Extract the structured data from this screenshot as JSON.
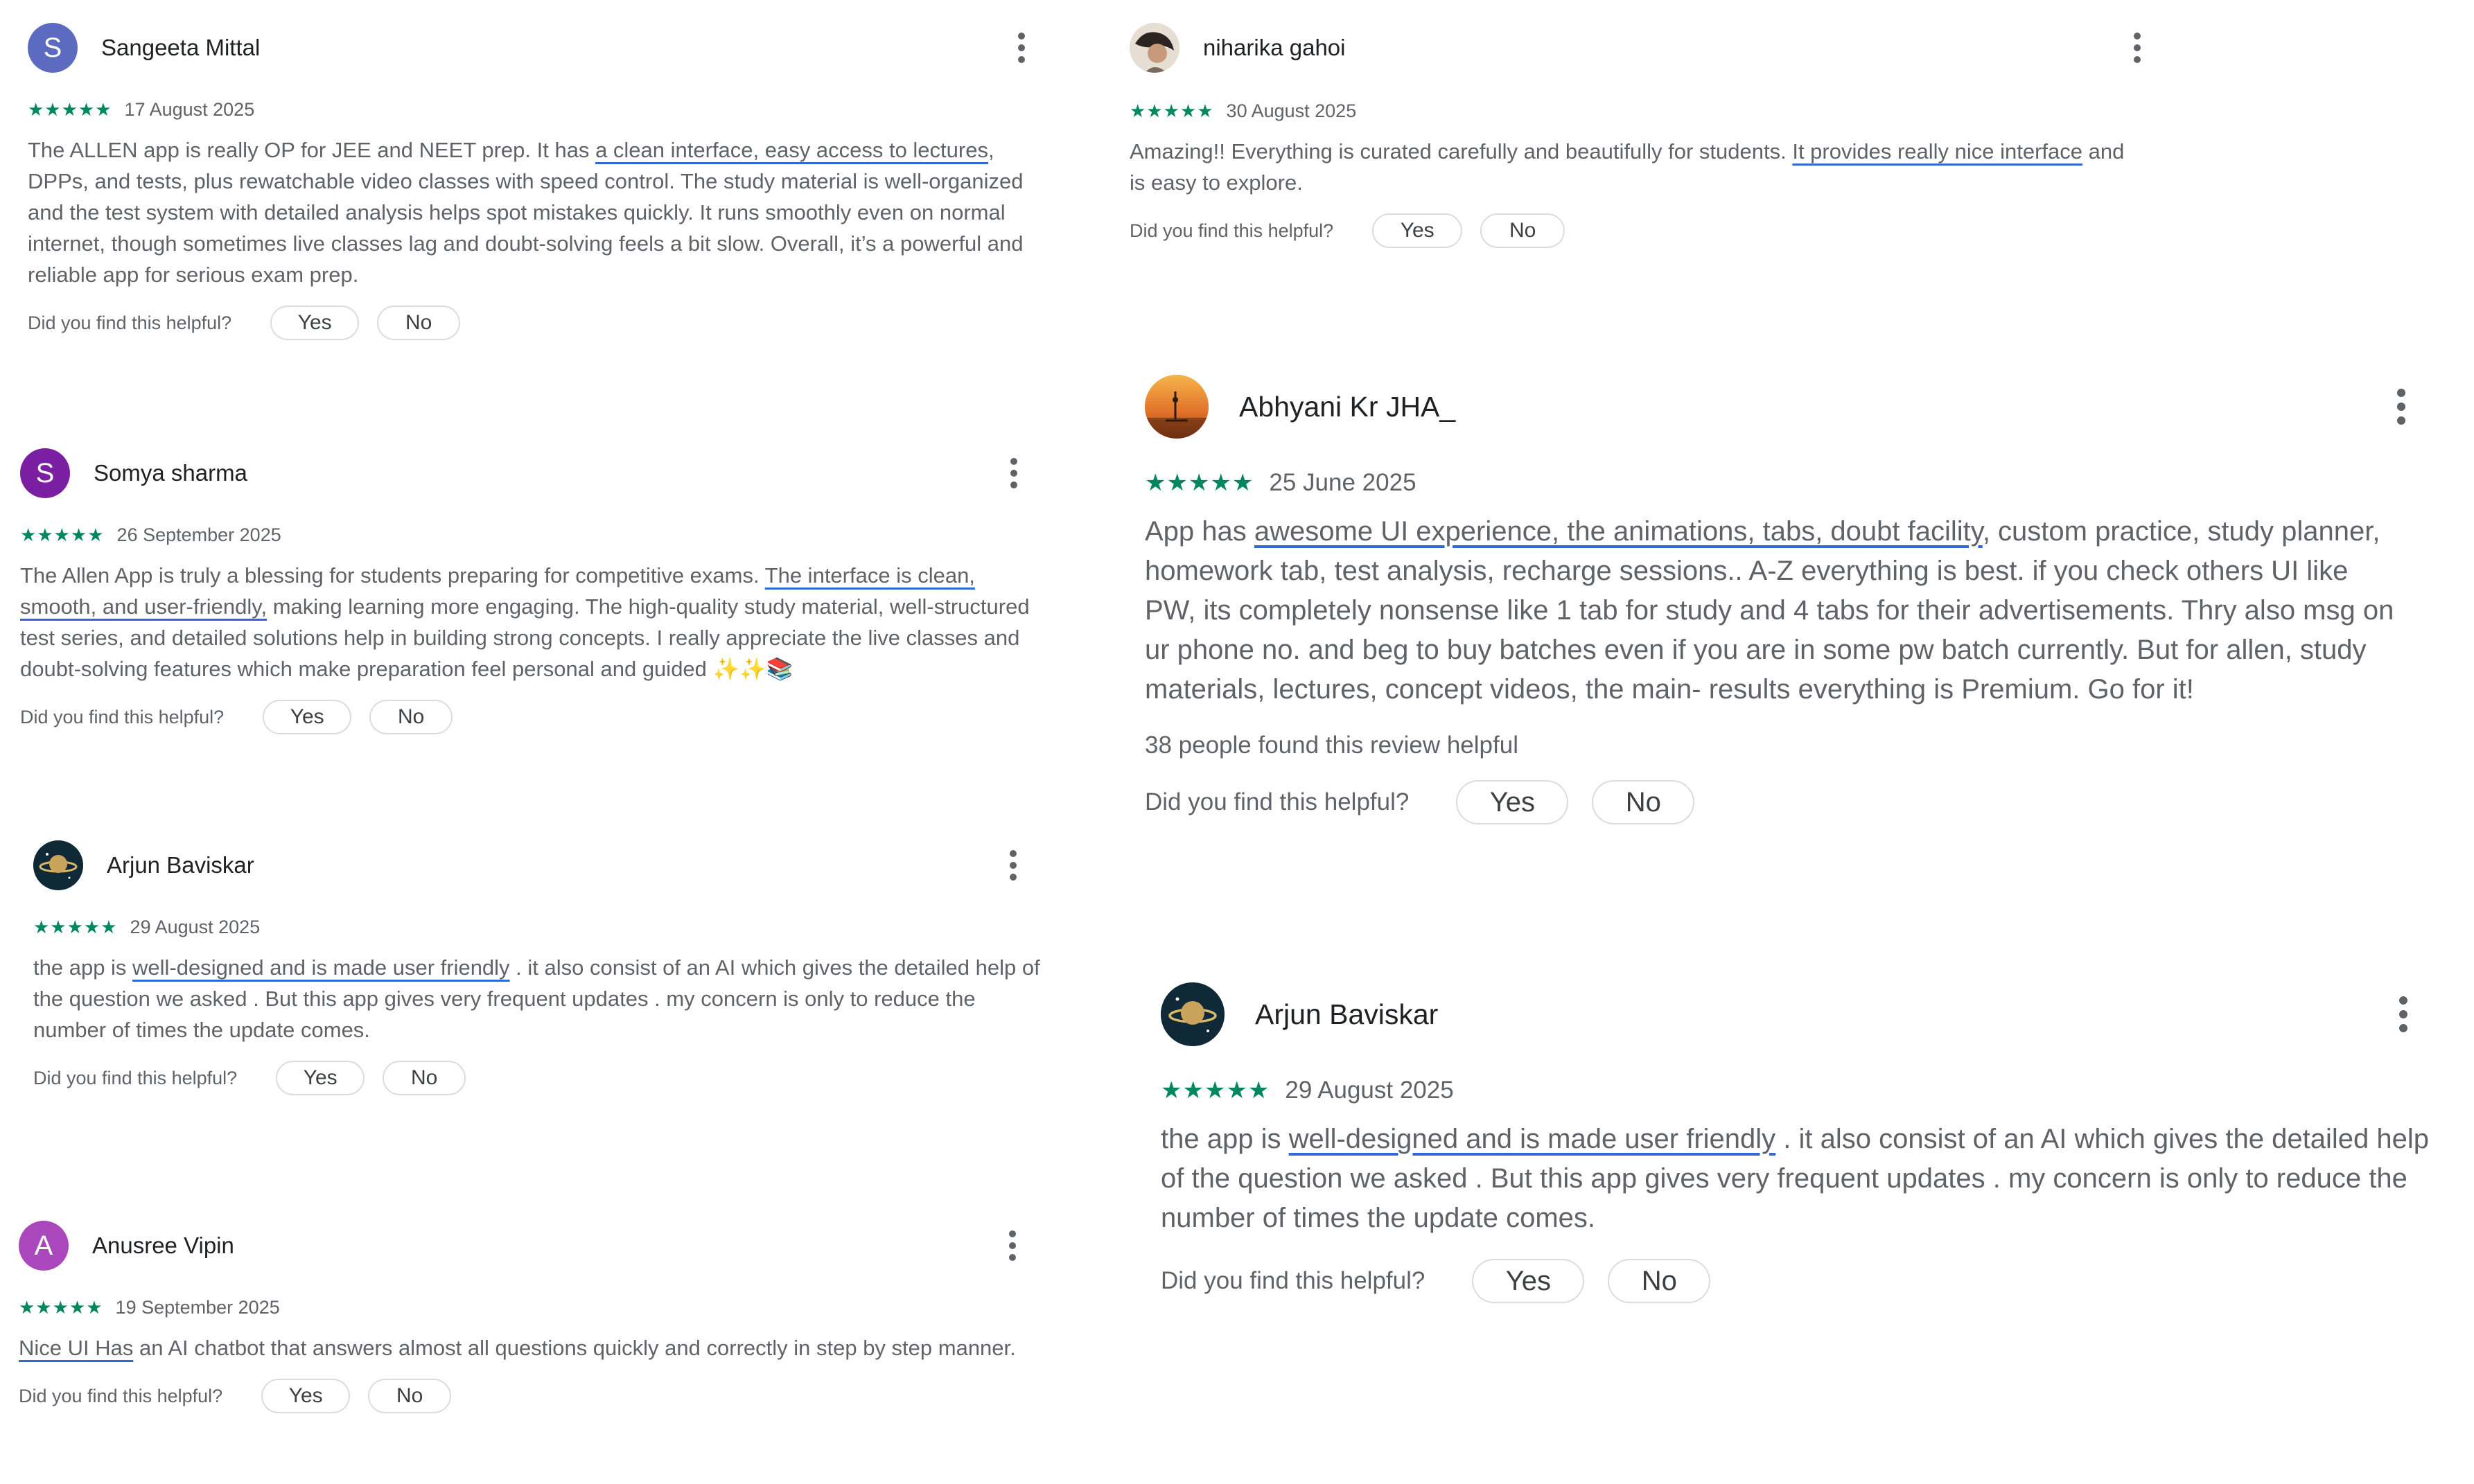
{
  "helpful_prompt": "Did you find this helpful?",
  "yes_label": "Yes",
  "no_label": "No",
  "stars": "★★★★★",
  "colors": {
    "star_green": "#01875f",
    "underline_blue": "#3367d6",
    "text_gray": "#5f6368"
  },
  "reviews": [
    {
      "author": "Sangeeta Mittal",
      "avatar_letter": "S",
      "avatar_color": "#5c6bc0",
      "rating": 5,
      "date": "17 August 2025",
      "text_before": "The ALLEN app is really OP for JEE and NEET prep. It has ",
      "text_highlight": "a clean interface, easy access to lectures",
      "text_after": ", DPPs, and tests, plus rewatchable video classes with speed control. The study material is well-organized and the test system with detailed analysis helps spot mistakes quickly. It runs smoothly even on normal internet, though sometimes live classes lag and doubt-solving feels a bit slow. Overall, it’s a powerful and reliable app for serious exam prep."
    },
    {
      "author": "Somya sharma",
      "avatar_letter": "S",
      "avatar_color": "#7b1fa2",
      "rating": 5,
      "date": "26 September 2025",
      "text_before": "The Allen App is truly a blessing for students preparing for competitive exams. ",
      "text_highlight": "The interface is clean, smooth, and user-friendly,",
      "text_after": " making learning more engaging. The high-quality study material, well-structured test series, and detailed solutions help in building strong concepts. I really appreciate the live classes and doubt-solving features which make preparation feel personal and guided ✨✨📚"
    },
    {
      "author": "Arjun Baviskar",
      "avatar_icon": "planet-avatar",
      "rating": 5,
      "date": "29 August 2025",
      "text_before": "the app is ",
      "text_highlight": "well-designed and is made user friendly",
      "text_after": " . it also consist of an AI which gives the detailed help of the question we asked . But this app gives very frequent updates . my concern is only to reduce the number of times the update comes."
    },
    {
      "author": "Anusree Vipin",
      "avatar_letter": "A",
      "avatar_color": "#ab47bc",
      "rating": 5,
      "date": "19 September 2025",
      "text_before": "",
      "text_highlight": "Nice UI Has",
      "text_after": " an AI chatbot that answers almost all questions quickly and correctly in step by step manner."
    },
    {
      "author": "niharika gahoi",
      "avatar_icon": "photo-avatar",
      "rating": 5,
      "date": "30 August 2025",
      "text_before": "Amazing!! Everything is curated carefully and beautifully for students. ",
      "text_highlight": "It provides really nice interface",
      "text_after": " and is easy to explore."
    },
    {
      "author": "Abhyani Kr JHA_",
      "avatar_icon": "sunset-avatar",
      "rating": 5,
      "date": "25 June 2025",
      "text_before": "App has ",
      "text_highlight": "awesome UI experience, the animations, tabs, doubt facility",
      "text_after": ", custom practice, study planner, homework tab, test analysis, recharge sessions.. A-Z everything is best. if you check others UI like PW, its completely nonsense like 1 tab for study and 4 tabs for their advertisements. Thry also msg on ur phone no. and beg to buy batches even if you are in some pw batch currently. But for allen, study materials, lectures, concept videos, the main- results everything is Premium. Go for it!",
      "helpful_count": "38 people found this review helpful"
    },
    {
      "author": "Arjun Baviskar",
      "avatar_icon": "planet-avatar",
      "rating": 5,
      "date": "29 August 2025",
      "text_before": "the app is ",
      "text_highlight": "well-designed and is made user friendly",
      "text_after": " . it also consist of an AI which gives the detailed help of the question we asked . But this app gives very frequent updates . my concern is only to reduce the number of times the update comes."
    }
  ]
}
